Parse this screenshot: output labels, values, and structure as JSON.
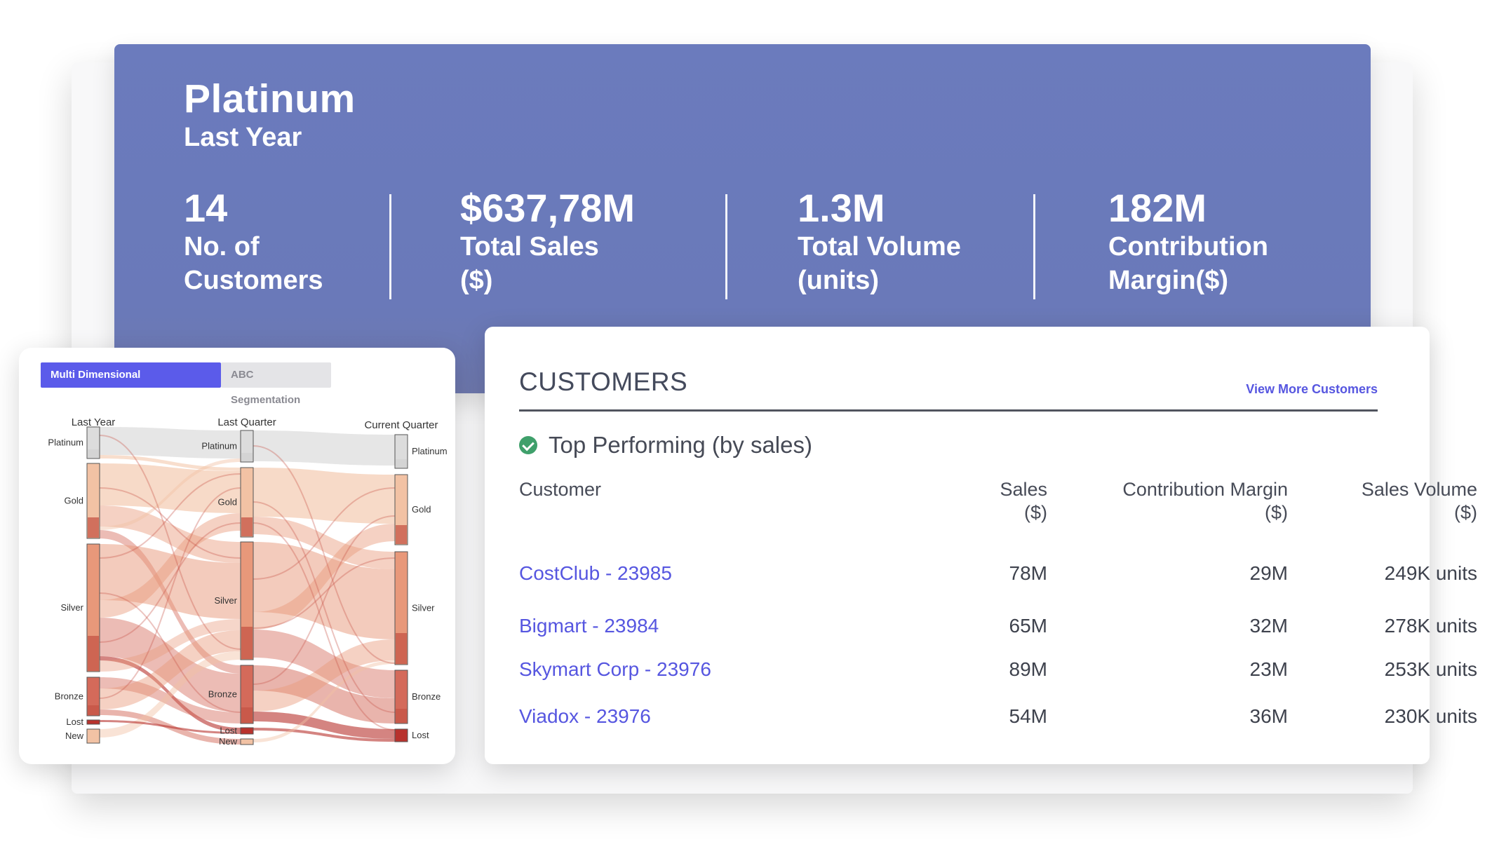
{
  "hero": {
    "title": "Platinum",
    "subtitle": "Last Year",
    "kpis": [
      {
        "value": "14",
        "label1": "No. of",
        "label2": "Customers"
      },
      {
        "value": "$637,78M",
        "label1": "Total Sales",
        "label2": "($)"
      },
      {
        "value": "1.3M",
        "label1": "Total Volume",
        "label2": "(units)"
      },
      {
        "value": "182M",
        "label1": "Contribution",
        "label2": "Margin($)"
      }
    ]
  },
  "segmentation": {
    "tabs": [
      "Multi Dimensional Segmentation",
      "ABC Segmentation"
    ],
    "active_tab": "Multi Dimensional Segmentation",
    "chart_data": {
      "type": "sankey",
      "stages": [
        "Last Year",
        "Last Quarter",
        "Current Quarter"
      ],
      "node_labels": {
        "Last Year": [
          "Platinum",
          "Gold",
          "Silver",
          "Bronze",
          "Lost",
          "New"
        ],
        "Last Quarter": [
          "Platinum",
          "Gold",
          "Silver",
          "Bronze",
          "Lost",
          "New"
        ],
        "Current Quarter": [
          "Platinum",
          "Gold",
          "Silver",
          "Bronze",
          "Lost"
        ]
      },
      "colors": {
        "platinum": "#dcdcdc",
        "gold": "#f2c2a4",
        "silver": "#e8987a",
        "bronze": "#d46a5a",
        "lost": "#b8322d"
      }
    }
  },
  "customers": {
    "title": "CUSTOMERS",
    "view_more": "View More Customers",
    "section_heading": "Top Performing (by sales)",
    "columns": {
      "customer": "Customer",
      "sales": "Sales",
      "sales_unit": "($)",
      "margin": "Contribution Margin",
      "margin_unit": "($)",
      "volume": "Sales Volume",
      "volume_unit": "($)"
    },
    "rows": [
      {
        "name": "CostClub - 23985",
        "sales": "78M",
        "margin": "29M",
        "volume": "249K units"
      },
      {
        "name": "Bigmart - 23984",
        "sales": "65M",
        "margin": "32M",
        "volume": "278K units"
      },
      {
        "name": "Skymart Corp - 23976",
        "sales": "89M",
        "margin": "23M",
        "volume": "253K units"
      },
      {
        "name": "Viadox - 23976",
        "sales": "54M",
        "margin": "36M",
        "volume": "230K units"
      }
    ]
  }
}
